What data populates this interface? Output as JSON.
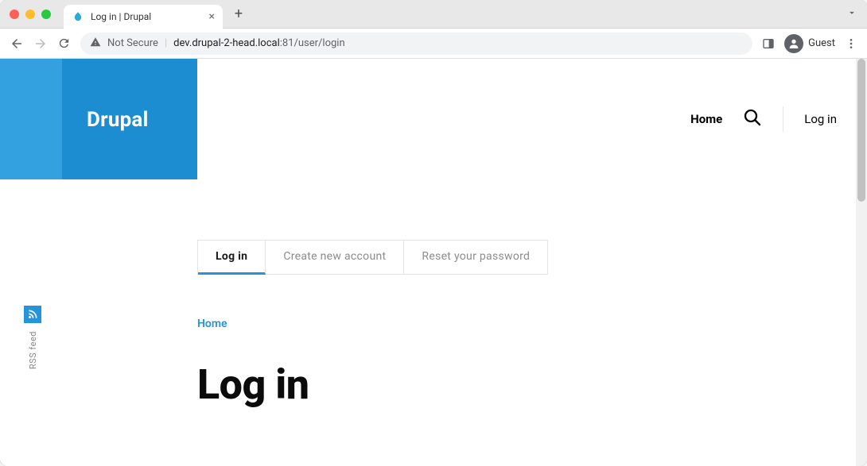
{
  "browser": {
    "tab_title": "Log in | Drupal",
    "security_label": "Not Secure",
    "url_host": "dev.drupal-2-head.local",
    "url_port": ":81",
    "url_path": "/user/login",
    "guest_label": "Guest"
  },
  "site": {
    "name": "Drupal"
  },
  "header_nav": {
    "home": "Home",
    "login": "Log in"
  },
  "sidebar": {
    "rss_label": "RSS feed"
  },
  "tabs": {
    "login": "Log in",
    "create": "Create new account",
    "reset": "Reset your password"
  },
  "breadcrumb": {
    "home": "Home"
  },
  "page": {
    "title": "Log in"
  }
}
